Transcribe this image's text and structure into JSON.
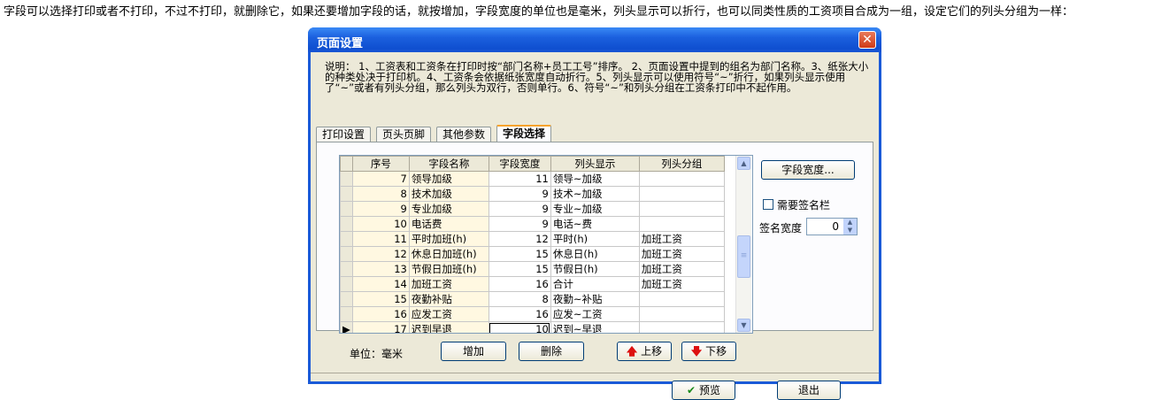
{
  "intro_text": "字段可以选择打印或者不打印，不过不打印，就删除它，如果还要增加字段的话，就按增加，字段宽度的单位也是毫米，列头显示可以折行，也可以同类性质的工资项目合成为一组，设定它们的列头分组为一样：",
  "window": {
    "title": "页面设置",
    "close_glyph": "✕"
  },
  "description": "说明： 1、工资表和工资条在打印时按“部门名称+员工工号”排序。 2、页面设置中提到的组名为部门名称。3、纸张大小的种类处决于打印机。4、工资条会依据纸张宽度自动折行。5、列头显示可以使用符号“~”折行，如果列头显示使用了“~”或者有列头分组，那么列头为双行，否则单行。6、符号“~”和列头分组在工资条打印中不起作用。",
  "tabs": [
    {
      "label": "打印设置",
      "active": false
    },
    {
      "label": "页头页脚",
      "active": false
    },
    {
      "label": "其他参数",
      "active": false
    },
    {
      "label": "字段选择",
      "active": true
    }
  ],
  "grid": {
    "columns": [
      "序号",
      "字段名称",
      "字段宽度",
      "列头显示",
      "列头分组"
    ],
    "rows": [
      {
        "no": "7",
        "name": "领导加级",
        "width": "11",
        "header": "领导~加级",
        "group": ""
      },
      {
        "no": "8",
        "name": "技术加级",
        "width": "9",
        "header": "技术~加级",
        "group": ""
      },
      {
        "no": "9",
        "name": "专业加级",
        "width": "9",
        "header": "专业~加级",
        "group": ""
      },
      {
        "no": "10",
        "name": "电话费",
        "width": "9",
        "header": "电话~费",
        "group": ""
      },
      {
        "no": "11",
        "name": "平时加班(h)",
        "width": "12",
        "header": "平时(h)",
        "group": "加班工资"
      },
      {
        "no": "12",
        "name": "休息日加班(h)",
        "width": "15",
        "header": "休息日(h)",
        "group": "加班工资"
      },
      {
        "no": "13",
        "name": "节假日加班(h)",
        "width": "15",
        "header": "节假日(h)",
        "group": "加班工资"
      },
      {
        "no": "14",
        "name": "加班工资",
        "width": "16",
        "header": "合计",
        "group": "加班工资"
      },
      {
        "no": "15",
        "name": "夜勤补贴",
        "width": "8",
        "header": "夜勤~补贴",
        "group": ""
      },
      {
        "no": "16",
        "name": "应发工资",
        "width": "16",
        "header": "应发~工资",
        "group": ""
      },
      {
        "no": "17",
        "name": "迟到早退",
        "width": "10",
        "header": "迟到~早退",
        "group": ""
      }
    ],
    "current_row_marker": "▶"
  },
  "right": {
    "field_width_button": "字段宽度...",
    "need_signature_label": "需要签名栏",
    "need_signature_checked": false,
    "signature_width_label": "签名宽度",
    "signature_width_value": "0"
  },
  "bottom": {
    "unit_label": "单位：毫米",
    "add_button": "增加",
    "delete_button": "删除",
    "move_up_button": "上移",
    "move_down_button": "下移",
    "preview_button": "预览",
    "exit_button": "退出"
  }
}
